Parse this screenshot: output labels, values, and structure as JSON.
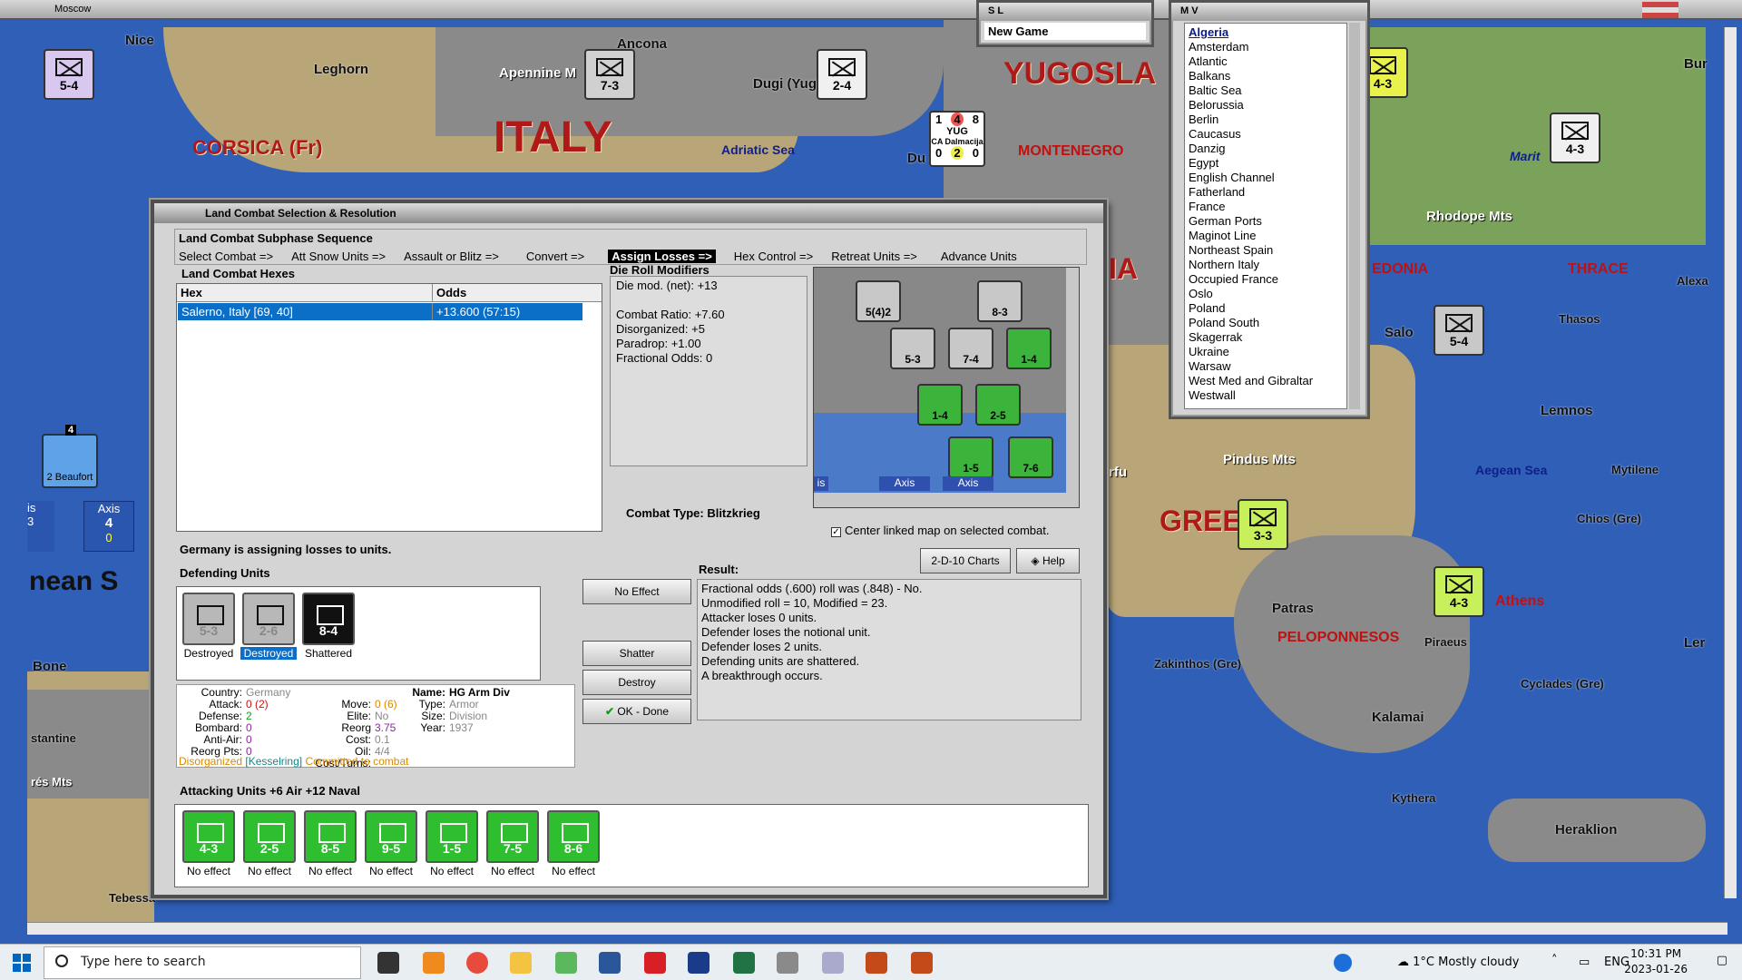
{
  "window": {
    "title": "Moscow"
  },
  "map": {
    "labels": {
      "nice": "Nice",
      "ancona": "Ancona",
      "leghorn": "Leghorn",
      "apennine": "Apennine M",
      "italy": "ITALY",
      "corsica": "CORSICA (Fr)",
      "adriatic": "Adriatic Sea",
      "dugi": "Dugi (Yug)",
      "yugosla": "YUGOSLA",
      "montenegro": "MONTENEGRO",
      "du": "Du",
      "rhodope": "Rhodope Mts",
      "thrace": "THRACE",
      "edonia": "EDONIA",
      "ia": "IA",
      "salon": "Salo",
      "thasos": "Thasos",
      "lemnos": "Lemnos",
      "pindus": "Pindus Mts",
      "aegean": "Aegean Sea",
      "mytilene": "Mytilene",
      "gree": "GREE",
      "chios": "Chios (Gre)",
      "patras": "Patras",
      "athens": "Athens",
      "peloponnesos": "PELOPONNESOS",
      "piraeus": "Piraeus",
      "zakinthos": "Zakinthos (Gre)",
      "cyclades": "Cyclades (Gre)",
      "kalamai": "Kalamai",
      "kythera": "Kythera",
      "heraklion": "Heraklion",
      "bone": "Bone",
      "nean_s": "nean S",
      "stantine": "stantine",
      "res_mts": "rés Mts",
      "tebessa": "Tebessa",
      "alexa": "Alexa",
      "bur": "Bur",
      "maritsa": "Marit",
      "rfu": "rfu",
      "ler": "Ler",
      "axis_box": "Axis",
      "axis_val": "4",
      "axis_sub": "0",
      "is_label": "is",
      "is_val": "3",
      "yug_dalmacija": "CA Dalmacija",
      "yug_nums": [
        "1",
        "4",
        "8",
        "0",
        "2",
        "0"
      ],
      "yug_tag": "YUG",
      "yug_top": "2"
    },
    "counters": [
      {
        "id": "c1",
        "value": "5-4",
        "color": "#d8c8f0"
      },
      {
        "id": "c2",
        "value": "7-3",
        "color": "#d0d0d0"
      },
      {
        "id": "c3",
        "value": "2-4",
        "color": "#f0f0f0"
      },
      {
        "id": "c4",
        "value": "4-3",
        "color": "#e9f24a"
      },
      {
        "id": "c5",
        "value": "4-3",
        "color": "#f0f0f0"
      },
      {
        "id": "c6",
        "value": "5-4",
        "color": "#c8c8c8"
      },
      {
        "id": "c7",
        "value": "3-3",
        "color": "#c8f05a"
      },
      {
        "id": "c8",
        "value": "4-3",
        "color": "#c8f05a"
      }
    ],
    "air_unit": {
      "label": "2 Beaufort",
      "top": "4"
    }
  },
  "sl_window": {
    "title": "S L",
    "item": "New Game"
  },
  "mv_window": {
    "title": "M V",
    "items": [
      "Algeria",
      "Amsterdam",
      "Atlantic",
      "Balkans",
      "Baltic Sea",
      "Belorussia",
      "Berlin",
      "Caucasus",
      "Danzig",
      "Egypt",
      "English Channel",
      "Fatherland",
      "France",
      "German Ports",
      "Maginot Line",
      "Northeast Spain",
      "Northern Italy",
      "Occupied France",
      "Oslo",
      "Poland",
      "Poland South",
      "Skagerrak",
      "Ukraine",
      "Warsaw",
      "West Med and Gibraltar",
      "Westwall"
    ]
  },
  "dialog": {
    "title": "Land Combat Selection & Resolution",
    "sequence_title": "Land Combat Subphase Sequence",
    "steps": [
      "Select Combat =>",
      "Att Snow Units =>",
      "Assault or Blitz =>",
      "Convert =>",
      "Assign Losses =>",
      "Hex Control =>",
      "Retreat Units =>",
      "Advance Units"
    ],
    "hexes_label": "Land Combat Hexes",
    "hex_col": "Hex",
    "odds_col": "Odds",
    "hex_row": {
      "hex": "Salerno, Italy [69, 40]",
      "odds": "+13.600 (57:15)"
    },
    "dr_label": "Die Roll Modifiers",
    "dr_lines": [
      "Die mod. (net): +13",
      "",
      "Combat Ratio: +7.60",
      "Disorganized: +5",
      "Paradrop: +1.00",
      "Fractional Odds: 0"
    ],
    "combat_type": "Combat Type:  Blitzkrieg",
    "center_check": "Center linked map on selected combat.",
    "mini_tabs": [
      "is",
      "Axis",
      "Axis"
    ],
    "mini_counters": [
      "5(4)2",
      "8-3",
      "5-3",
      "7-4",
      "1-4",
      "1-4",
      "2-5",
      "1-5",
      "7-6"
    ],
    "status": "Germany is assigning losses to units.",
    "defending_label": "Defending Units",
    "defenders": [
      {
        "value": "5-3",
        "status": "Destroyed",
        "style": "grey",
        "selected": false
      },
      {
        "value": "2-6",
        "status": "Destroyed",
        "style": "grey",
        "selected": true
      },
      {
        "value": "8-4",
        "status": "Shattered",
        "style": "black",
        "selected": false
      }
    ],
    "buttons": {
      "no_effect": "No Effect",
      "shatter": "Shatter",
      "destroy": "Destroy",
      "ok_done": "OK - Done",
      "charts": "2-D-10 Charts",
      "help": "Help"
    },
    "result_label": "Result:",
    "result_lines": [
      "Fractional odds (.600) roll was (.848)  - No.",
      "Unmodified roll = 10, Modified = 23.",
      "Attacker loses 0 units.",
      "Defender loses the notional unit.",
      "Defender loses 2 units.",
      "Defending units are shattered.",
      "A breakthrough occurs."
    ],
    "unit_info": {
      "country_lbl": "Country:",
      "country": "Germany",
      "attack_lbl": "Attack:",
      "attack": "0 (2)",
      "defense_lbl": "Defense:",
      "defense": "2",
      "bombard_lbl": "Bombard:",
      "bombard": "0",
      "antiair_lbl": "Anti-Air:",
      "antiair": "0",
      "reorg_lbl": "Reorg Pts:",
      "reorg": "0",
      "move_lbl": "Move:",
      "move": "0 (6)",
      "elite_lbl": "Elite:",
      "elite": "No",
      "reorgcost_lbl": "Reorg Cost:",
      "reorgcost": "3.75",
      "oil_lbl": "Oil:",
      "oil": "0.1",
      "cost_lbl": "Cost/Turns:",
      "cost": "4/4",
      "name_lbl": "Name:",
      "name": "HG Arm Div",
      "type_lbl": "Type:",
      "type": "Armor",
      "size_lbl": "Size:",
      "size": "Division",
      "year_lbl": "Year:",
      "year": "1937",
      "flag_disorg": "Disorganized",
      "flag_hq": "[Kesselring]",
      "flag_comm": "Committed to combat"
    },
    "attacking_label": "Attacking Units +6 Air +12 Naval",
    "attackers": [
      {
        "value": "4-3",
        "status": "No effect"
      },
      {
        "value": "2-5",
        "status": "No effect"
      },
      {
        "value": "8-5",
        "status": "No effect"
      },
      {
        "value": "9-5",
        "status": "No effect"
      },
      {
        "value": "1-5",
        "status": "No effect"
      },
      {
        "value": "7-5",
        "status": "No effect"
      },
      {
        "value": "8-6",
        "status": "No effect"
      }
    ]
  },
  "taskbar": {
    "search_placeholder": "Type here to search",
    "weather": "1°C  Mostly cloudy",
    "lang": "ENG",
    "time": "10:31 PM",
    "date": "2023-01-26"
  }
}
